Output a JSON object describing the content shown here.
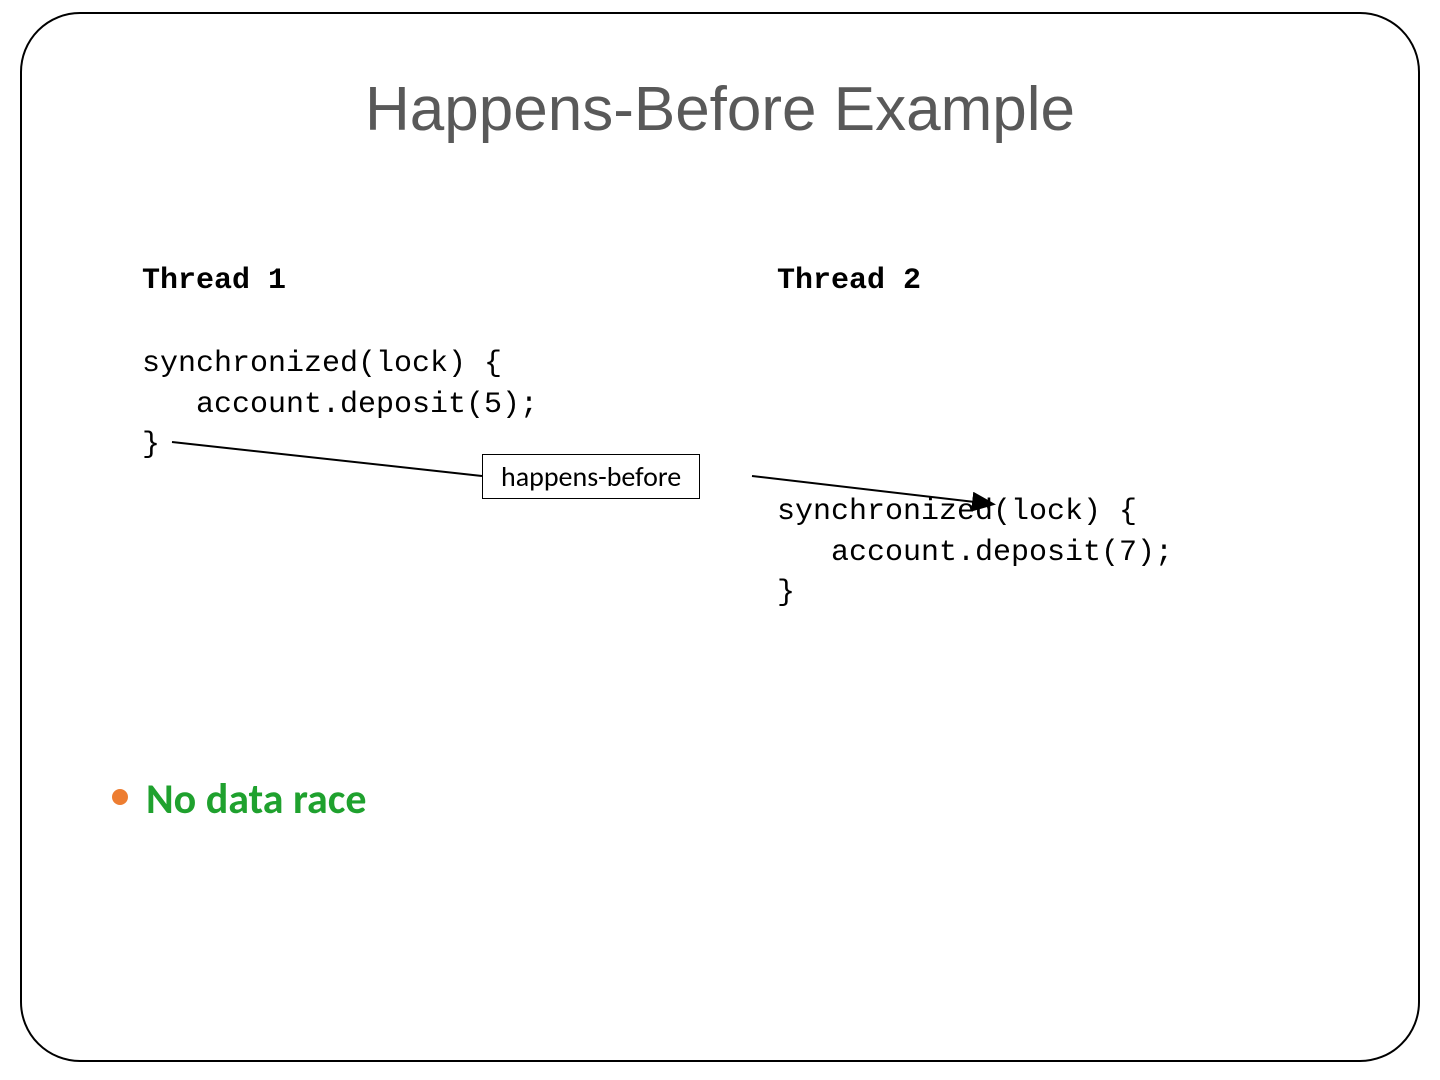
{
  "title": "Happens-Before Example",
  "threads": {
    "thread1": {
      "label": "Thread 1",
      "code": "synchronized(lock) {\n   account.deposit(5);\n}"
    },
    "thread2": {
      "label": "Thread 2",
      "code": "synchronized(lock) {\n   account.deposit(7);\n}"
    }
  },
  "arrow_label": "happens-before",
  "bullet": {
    "text": "No data race"
  }
}
